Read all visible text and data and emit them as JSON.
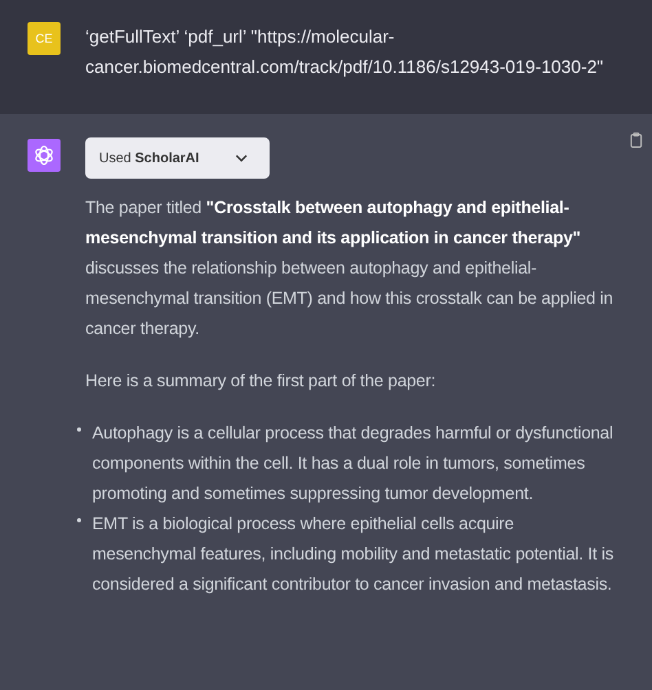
{
  "messages": [
    {
      "kind": "user",
      "avatar": "CE",
      "text": "‘getFullText’ ‘pdf_url’ \"https://molecular-cancer.biomedcentral.com/track/pdf/10.1186/s12943-019-1030-2\""
    },
    {
      "kind": "assistant",
      "tool": {
        "prefix": "Used",
        "name": "ScholarAI",
        "expanded": false
      },
      "blocks": [
        {
          "kind": "paragraph",
          "text": "The paper titled **\"Crosstalk between autophagy and epithelial-mesenchymal transition and its application in cancer therapy\"** discusses the relationship between autophagy and epithelial-mesenchymal transition (EMT) and how this crosstalk can be applied in cancer therapy."
        },
        {
          "kind": "paragraph",
          "text": "Here is a summary of the first part of the paper:"
        },
        {
          "kind": "list",
          "items": [
            "Autophagy is a cellular process that degrades harmful or dysfunctional components within the cell. It has a dual role in tumors, sometimes promoting and sometimes suppressing tumor development.",
            "EMT is a biological process where epithelial cells acquire mesenchymal features, including mobility and metastatic potential. It is considered a significant contributor to cancer invasion and metastasis."
          ]
        }
      ]
    }
  ]
}
